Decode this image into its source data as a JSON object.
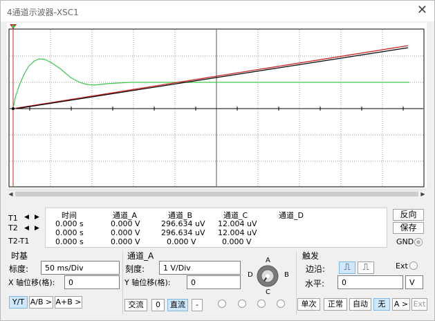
{
  "window": {
    "title": "4通道示波器-XSC1",
    "close_glyph": "✕"
  },
  "readout": {
    "row_labels": [
      "T1",
      "T2",
      "T2-T1"
    ],
    "headers": [
      "时间",
      "通道_A",
      "通道_B",
      "通道_C",
      "通道_D"
    ],
    "rows": [
      [
        "0.000 s",
        "0.000 V",
        "296.634 uV",
        "12.004 uV",
        ""
      ],
      [
        "0.000 s",
        "0.000 V",
        "296.634 uV",
        "12.004 uV",
        ""
      ],
      [
        "0.000 s",
        "0.000 V",
        "0.000 V",
        "0.000 V",
        ""
      ]
    ],
    "reverse_label": "反向",
    "save_label": "保存",
    "gnd_label": "GND"
  },
  "timebase": {
    "title": "时基",
    "scale_label": "标度:",
    "scale_value": "50 ms/Div",
    "xpos_label": "X 轴位移(格):",
    "xpos_value": "0",
    "mode_buttons": [
      "Y/T",
      "A/B >",
      "A+B >"
    ]
  },
  "channel": {
    "title": "通道_A",
    "scale_label": "刻度:",
    "scale_value": "1  V/Div",
    "ypos_label": "Y 轴位移(格):",
    "ypos_value": "0",
    "coupling_buttons": [
      "交流",
      "0",
      "直流",
      "-"
    ],
    "selector_labels": [
      "A",
      "B",
      "C",
      "D"
    ]
  },
  "trigger": {
    "title": "触发",
    "edge_label": "边沿:",
    "ext_label": "Ext",
    "level_label": "水平:",
    "level_value": "0",
    "level_unit": "V",
    "mode_buttons": [
      "单次",
      "正常",
      "自动",
      "无",
      "A >",
      "Ext"
    ]
  },
  "colors": {
    "trace_a": "#39c94a",
    "trace_b": "#cc2222",
    "trace_c": "#000000",
    "active_button": "#cde8ff"
  }
}
